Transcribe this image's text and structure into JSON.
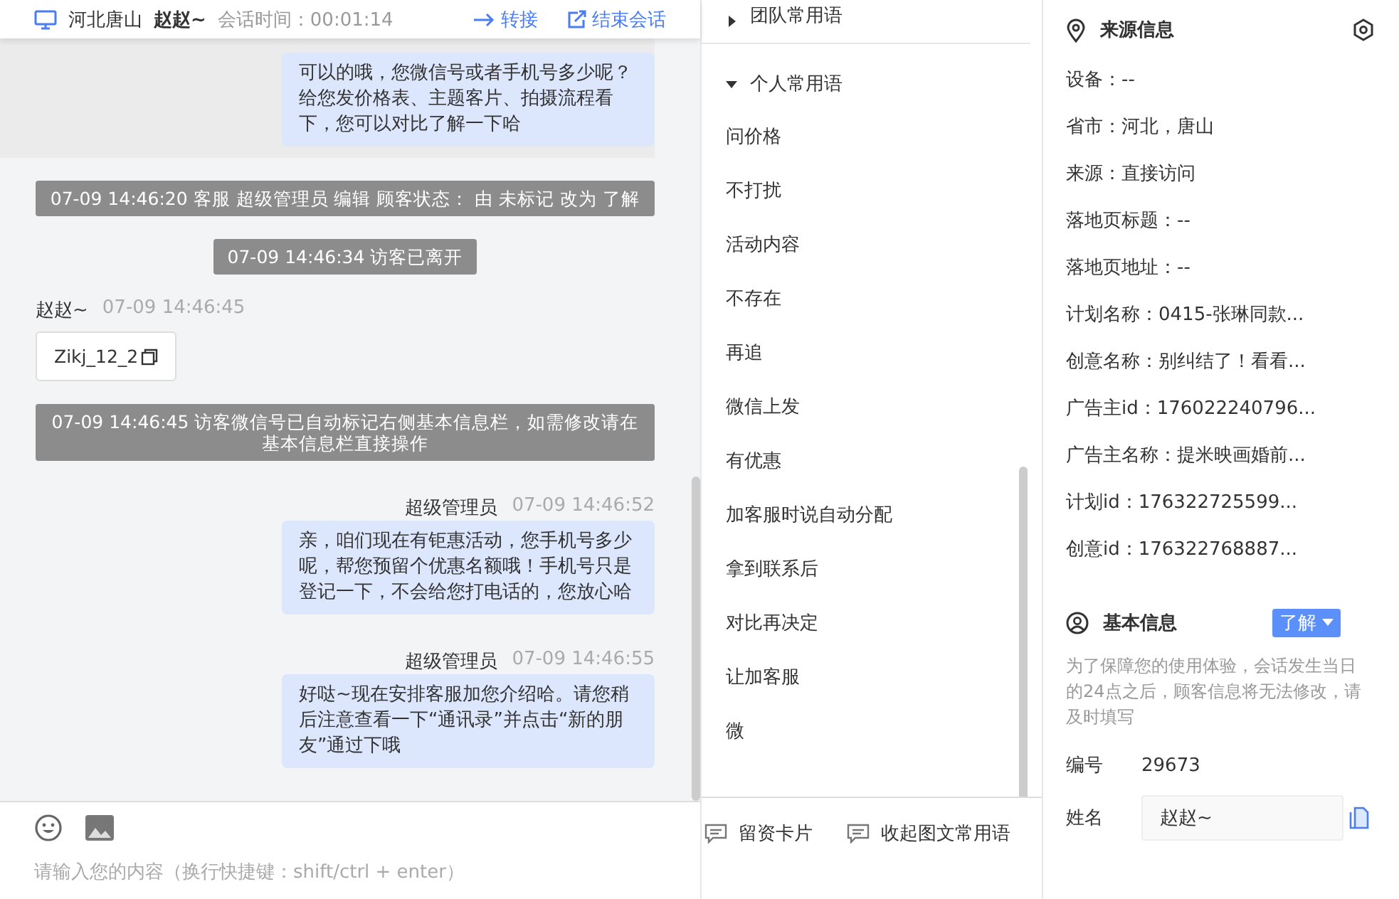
{
  "header": {
    "location": "河北唐山",
    "visitor_name": "赵赵~",
    "session_time": "会话时间：00:01:14",
    "transfer": "转接",
    "end_session": "结束会话"
  },
  "messages": [
    {
      "kind": "agent",
      "highlighted": true,
      "text": "可以的哦，您微信号或者手机号多少呢？给您发价格表、主题客片、拍摄流程看下，您可以对比了解一下哈"
    },
    {
      "kind": "system",
      "text": "07-09 14:46:20 客服 超级管理员 编辑 顾客状态： 由 未标记 改为 了解"
    },
    {
      "kind": "system",
      "text": "07-09 14:46:34 访客已离开"
    },
    {
      "kind": "visitor",
      "sender": "赵赵~",
      "time": "07-09 14:46:45",
      "text": "Zikj_12_2"
    },
    {
      "kind": "system",
      "text": "07-09 14:46:45 访客微信号已自动标记右侧基本信息栏，如需修改请在基本信息栏直接操作"
    },
    {
      "kind": "agent",
      "highlighted": false,
      "sender": "超级管理员",
      "time": "07-09 14:46:52",
      "text": "亲，咱们现在有钜惠活动，您手机号多少呢，帮您预留个优惠名额哦！手机号只是登记一下，不会给您打电话的，您放心哈"
    },
    {
      "kind": "agent",
      "highlighted": false,
      "sender": "超级管理员",
      "time": "07-09 14:46:55",
      "text": "好哒~现在安排客服加您介绍哈。请您稍后注意查看一下“通讯录”并点击“新的朋友”通过下哦"
    }
  ],
  "composer": {
    "placeholder": "请输入您的内容（换行快捷键：shift/ctrl + enter）"
  },
  "phrases": {
    "groups": [
      {
        "title": "团队常用语",
        "expanded": false
      },
      {
        "title": "个人常用语",
        "expanded": true
      }
    ],
    "items": [
      "问价格",
      "不打扰",
      "活动内容",
      "不存在",
      "再追",
      "微信上发",
      "有优惠",
      "加客服时说自动分配",
      "拿到联系后",
      "对比再决定",
      "让加客服",
      "微"
    ],
    "buttons": [
      "留资卡片",
      "收起图文常用语"
    ]
  },
  "source_info": {
    "title": "来源信息",
    "rows": [
      "设备：--",
      "省市：河北，唐山",
      "来源：直接访问",
      "落地页标题：--",
      "落地页地址：--",
      "计划名称：0415-张琳同款...",
      "创意名称：别纠结了！看看...",
      "广告主id：176022240796...",
      "广告主名称：提米映画婚前...",
      "计划id：176322725599...",
      "创意id：176322768887..."
    ]
  },
  "basic_info": {
    "title": "基本信息",
    "status_button": "了解",
    "note": "为了保障您的使用体验，会话发生当日的24点之后，顾客信息将无法修改，请及时填写",
    "number_label": "编号",
    "number_value": "29673",
    "name_label": "姓名",
    "name_value": "赵赵~"
  }
}
